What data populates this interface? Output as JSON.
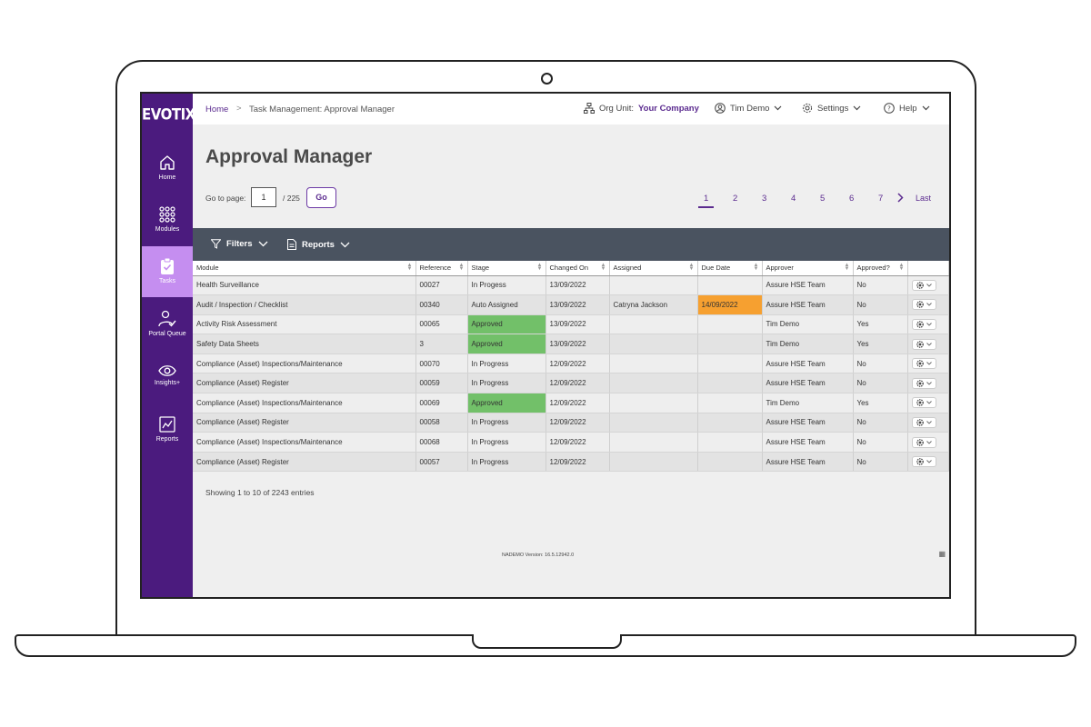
{
  "brand": {
    "logo": "EVOTIX"
  },
  "sidebar": {
    "items": [
      {
        "label": "Home",
        "icon": "home-icon"
      },
      {
        "label": "Modules",
        "icon": "grid-icon"
      },
      {
        "label": "Tasks",
        "icon": "clipboard-check-icon",
        "active": true
      },
      {
        "label": "Portal Queue",
        "icon": "user-check-icon"
      },
      {
        "label": "Insights+",
        "icon": "eye-icon"
      },
      {
        "label": "Reports",
        "icon": "chart-icon"
      }
    ]
  },
  "header": {
    "breadcrumb_home": "Home",
    "breadcrumb_separator": ">",
    "breadcrumb_current": "Task Management: Approval Manager",
    "org_unit_label": "Org Unit:",
    "org_unit_value": "Your Company",
    "user": "Tim Demo",
    "settings": "Settings",
    "help": "Help"
  },
  "page": {
    "title": "Approval Manager",
    "goto_label": "Go to page:",
    "goto_value": "1",
    "goto_total": "/ 225",
    "go_label": "Go"
  },
  "pagination": {
    "pages": [
      "1",
      "2",
      "3",
      "4",
      "5",
      "6",
      "7"
    ],
    "current": "1",
    "next": ">",
    "last": "Last"
  },
  "toolbar": {
    "filters": "Filters",
    "reports": "Reports"
  },
  "table": {
    "columns": [
      "Module",
      "Reference",
      "Stage",
      "Changed On",
      "Assigned",
      "Due Date",
      "Approver",
      "Approved?",
      ""
    ],
    "rows": [
      [
        "Health Surveillance",
        "00027",
        "In Progess",
        "13/09/2022",
        "",
        "",
        "Assure HSE Team",
        "No"
      ],
      [
        "Audit / Inspection / Checklist",
        "00340",
        "Auto Assigned",
        "13/09/2022",
        "Catryna Jackson",
        "14/09/2022",
        "Assure HSE Team",
        "No"
      ],
      [
        "Activity Risk Assessment",
        "00065",
        "Approved",
        "13/09/2022",
        "",
        "",
        "Tim Demo",
        "Yes"
      ],
      [
        "Safety Data Sheets",
        "3",
        "Approved",
        "13/09/2022",
        "",
        "",
        "Tim Demo",
        "Yes"
      ],
      [
        "Compliance (Asset) Inspections/Maintenance",
        "00070",
        "In Progress",
        "12/09/2022",
        "",
        "",
        "Assure HSE Team",
        "No"
      ],
      [
        "Compliance (Asset) Register",
        "00059",
        "In Progress",
        "12/09/2022",
        "",
        "",
        "Assure HSE Team",
        "No"
      ],
      [
        "Compliance (Asset) Inspections/Maintenance",
        "00069",
        "Approved",
        "12/09/2022",
        "",
        "",
        "Tim Demo",
        "Yes"
      ],
      [
        "Compliance (Asset) Register",
        "00058",
        "In Progress",
        "12/09/2022",
        "",
        "",
        "Assure HSE Team",
        "No"
      ],
      [
        "Compliance (Asset) Inspections/Maintenance",
        "00068",
        "In Progress",
        "12/09/2022",
        "",
        "",
        "Assure HSE Team",
        "No"
      ],
      [
        "Compliance (Asset) Register",
        "00057",
        "In Progress",
        "12/09/2022",
        "",
        "",
        "Assure HSE Team",
        "No"
      ]
    ],
    "approved_color": "#72c069",
    "due_highlight_color": "#f6a030",
    "action_icon": "gear-icon"
  },
  "footer": {
    "entries": "Showing 1 to 10 of 2243 entries",
    "version": "NADEMO Version: 16.5.12942.0"
  },
  "colors": {
    "sidebar": "#4b1b7e",
    "accent": "#5b2b8f",
    "toolbar": "#4a5360"
  }
}
